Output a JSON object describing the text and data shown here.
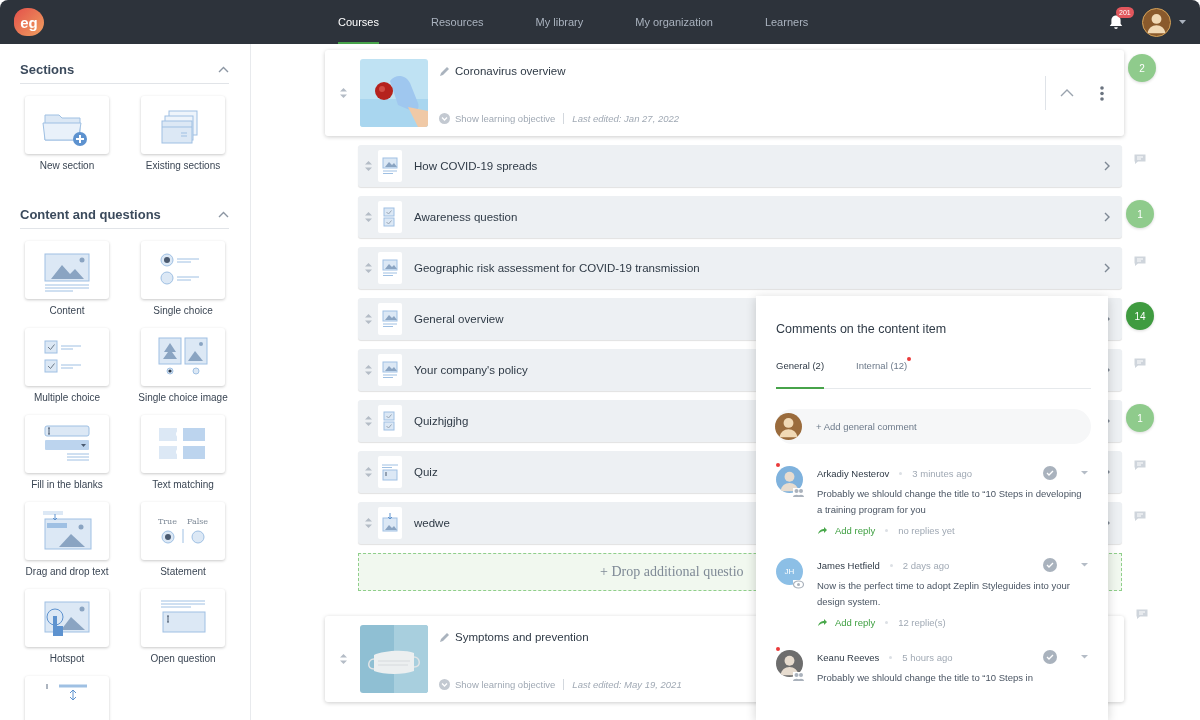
{
  "app": {
    "logo": "eg"
  },
  "nav": [
    {
      "label": "Courses",
      "selected": true
    },
    {
      "label": "Resources",
      "selected": false
    },
    {
      "label": "My library",
      "selected": false
    },
    {
      "label": "My organization",
      "selected": false
    },
    {
      "label": "Learners",
      "selected": false
    }
  ],
  "notifications": {
    "count": "201"
  },
  "sidebar": {
    "groups": [
      {
        "title": "Sections",
        "expanded": true,
        "tile_rows": [
          [
            {
              "kind": "new-section",
              "label": "New section"
            },
            {
              "kind": "existing-sections",
              "label": "Existing sections"
            }
          ]
        ]
      },
      {
        "title": "Content and questions",
        "expanded": true,
        "tile_rows": [
          [
            {
              "kind": "content",
              "label": "Content"
            },
            {
              "kind": "single-choice",
              "label": "Single choice"
            }
          ],
          [
            {
              "kind": "multiple-choice",
              "label": "Multiple choice"
            },
            {
              "kind": "single-choice-image",
              "label": "Single choice image"
            }
          ],
          [
            {
              "kind": "fill-blanks",
              "label": "Fill in the blanks"
            },
            {
              "kind": "text-matching",
              "label": "Text matching"
            }
          ],
          [
            {
              "kind": "drag-drop",
              "label": "Drag and drop text"
            },
            {
              "kind": "statement",
              "label": "Statement",
              "true_label": "True",
              "false_label": "False"
            }
          ],
          [
            {
              "kind": "hotspot",
              "label": "Hotspot"
            },
            {
              "kind": "open-question",
              "label": "Open question"
            }
          ],
          [
            {
              "kind": "ordering"
            }
          ]
        ]
      }
    ]
  },
  "sections": [
    {
      "title": "Coronavirus overview",
      "objective_link": "Show learning objective",
      "last_edited": "Last edited: Jan 27, 2022",
      "expanded": true,
      "side": {
        "kind": "badge",
        "count": "2",
        "color": "#8fcb8c"
      },
      "items": [
        {
          "kind": "content",
          "title": "How COVID-19 spreads",
          "side": {
            "kind": "comment"
          }
        },
        {
          "kind": "multiple-choice",
          "title": "Awareness question",
          "side": {
            "kind": "badge",
            "count": "1",
            "color": "#8fcb8c"
          }
        },
        {
          "kind": "content",
          "title": "Geographic risk assessment for COVID-19 transmission",
          "side": {
            "kind": "comment"
          }
        },
        {
          "kind": "content",
          "title": "General overview",
          "side": {
            "kind": "badge",
            "count": "14",
            "color": "#3f9b40"
          }
        },
        {
          "kind": "content",
          "title": "Your company's policy",
          "side": {
            "kind": "comment"
          }
        },
        {
          "kind": "multiple-choice",
          "title": "Quizhjgjhg",
          "side": {
            "kind": "badge",
            "count": "1",
            "color": "#8fcb8c"
          }
        },
        {
          "kind": "open-question",
          "title": "Quiz",
          "side": {
            "kind": "comment"
          }
        },
        {
          "kind": "drag-drop",
          "title": "wedwe",
          "side": {
            "kind": "comment"
          }
        }
      ],
      "dropzone": "+ Drop additional questio"
    },
    {
      "title": "Symptoms and prevention",
      "objective_link": "Show learning objective",
      "last_edited": "Last edited: May 19, 2021",
      "side": {
        "kind": "comment"
      }
    }
  ],
  "comments_panel": {
    "title": "Comments on the content item",
    "tabs": [
      {
        "label": "General (2)",
        "selected": true,
        "unread": false
      },
      {
        "label": "Internal (12)",
        "selected": false,
        "unread": true
      }
    ],
    "add_comment": "+ Add general comment",
    "comments": [
      {
        "author": "Arkadiy Nesterov",
        "time": "3 minutes ago",
        "text": "Probably we shlould change the title to “10 Steps in developing a training program for you",
        "reply_link": "Add reply",
        "replies": "no replies yet",
        "unread": true,
        "role_badge": {
          "kind": "group"
        }
      },
      {
        "author": "James Hetfield",
        "time": "2 days ago",
        "text": "Now is the perfect time to adopt Zeplin Styleguides into your design system.",
        "reply_link": "Add reply",
        "replies": "12 replie(s)",
        "unread": false,
        "role_badge": {
          "kind": "viewer"
        },
        "avatar": {
          "kind": "initials",
          "initials": "JH",
          "color": "#8cbfe6"
        }
      },
      {
        "author": "Keanu Reeves",
        "time": "5 hours ago",
        "text": "Probably we shlould change the title to “10 Steps in",
        "unread": true,
        "role_badge": {
          "kind": "group"
        }
      }
    ]
  }
}
